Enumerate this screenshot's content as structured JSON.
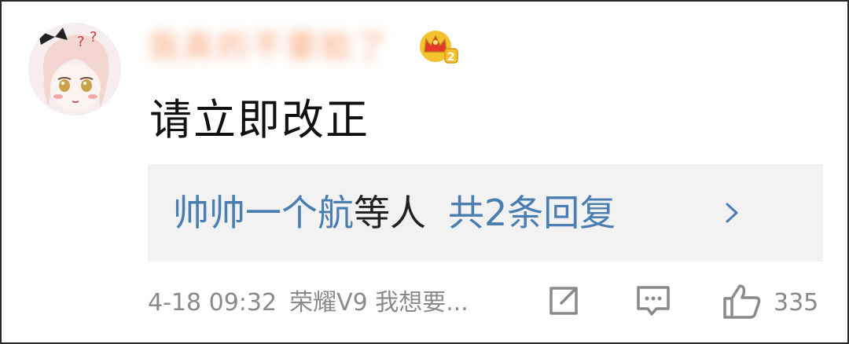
{
  "comment": {
    "username": "我真的不要脸了",
    "badge_icon": "crown-level-2-icon",
    "text": "请立即改正",
    "replies": {
      "names": "帅帅一个航",
      "others": "等人",
      "count_label": "共2条回复",
      "chevron_icon": "chevron-right-icon"
    },
    "footer": {
      "time": "4-18 09:32",
      "device": "荣耀V9 我想要...",
      "share_icon": "share-icon",
      "comment_icon": "comment-icon",
      "like_icon": "thumbs-up-icon",
      "like_count": "335"
    }
  },
  "colors": {
    "link_blue": "#4a7db1",
    "meta_gray": "#8a8a8a",
    "reply_bg": "#f2f2f2",
    "username_orange": "#f7a376"
  }
}
